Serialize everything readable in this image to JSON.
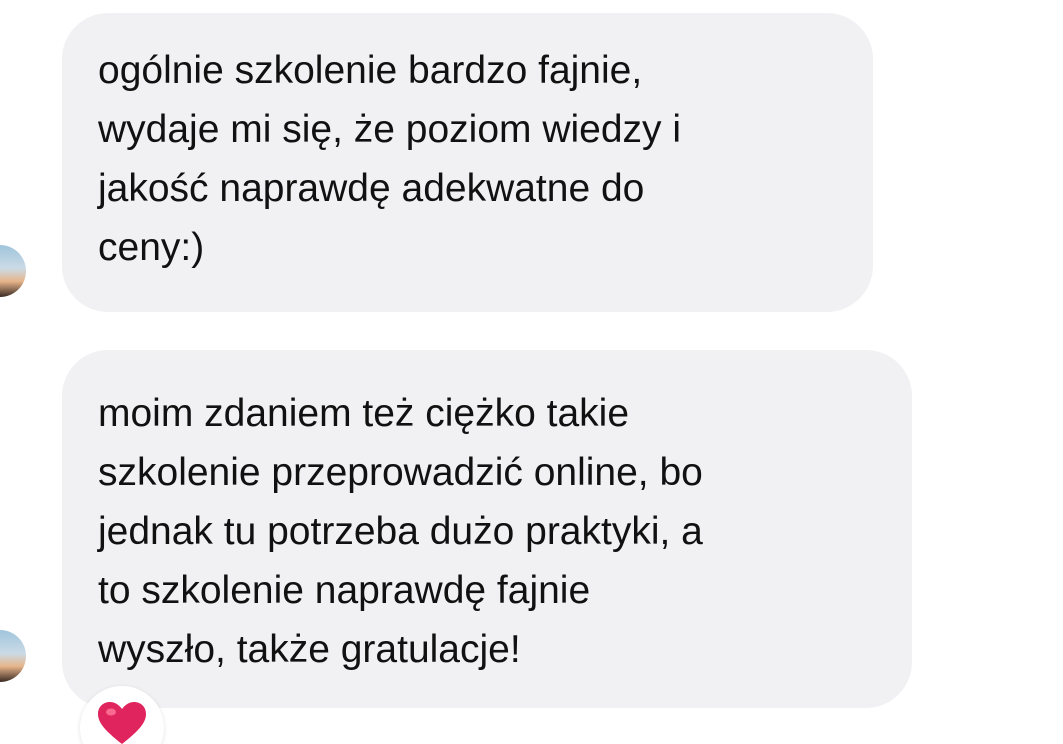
{
  "messages": [
    {
      "lines": [
        "ogólnie szkolenie bardzo fajnie,",
        "wydaje mi się, że poziom wiedzy i",
        "jakość naprawdę adekwatne do",
        "ceny:)"
      ]
    },
    {
      "lines": [
        "moim zdaniem też ciężko takie",
        "szkolenie przeprowadzić online, bo",
        "jednak tu potrzeba dużo praktyki, a",
        "to szkolenie naprawdę fajnie",
        "wyszło, także gratulacje!"
      ],
      "reaction": "heart-icon"
    }
  ],
  "colors": {
    "bubble_background": "#f1f1f3",
    "text": "#111111",
    "reaction_heart": "#e0245e"
  }
}
